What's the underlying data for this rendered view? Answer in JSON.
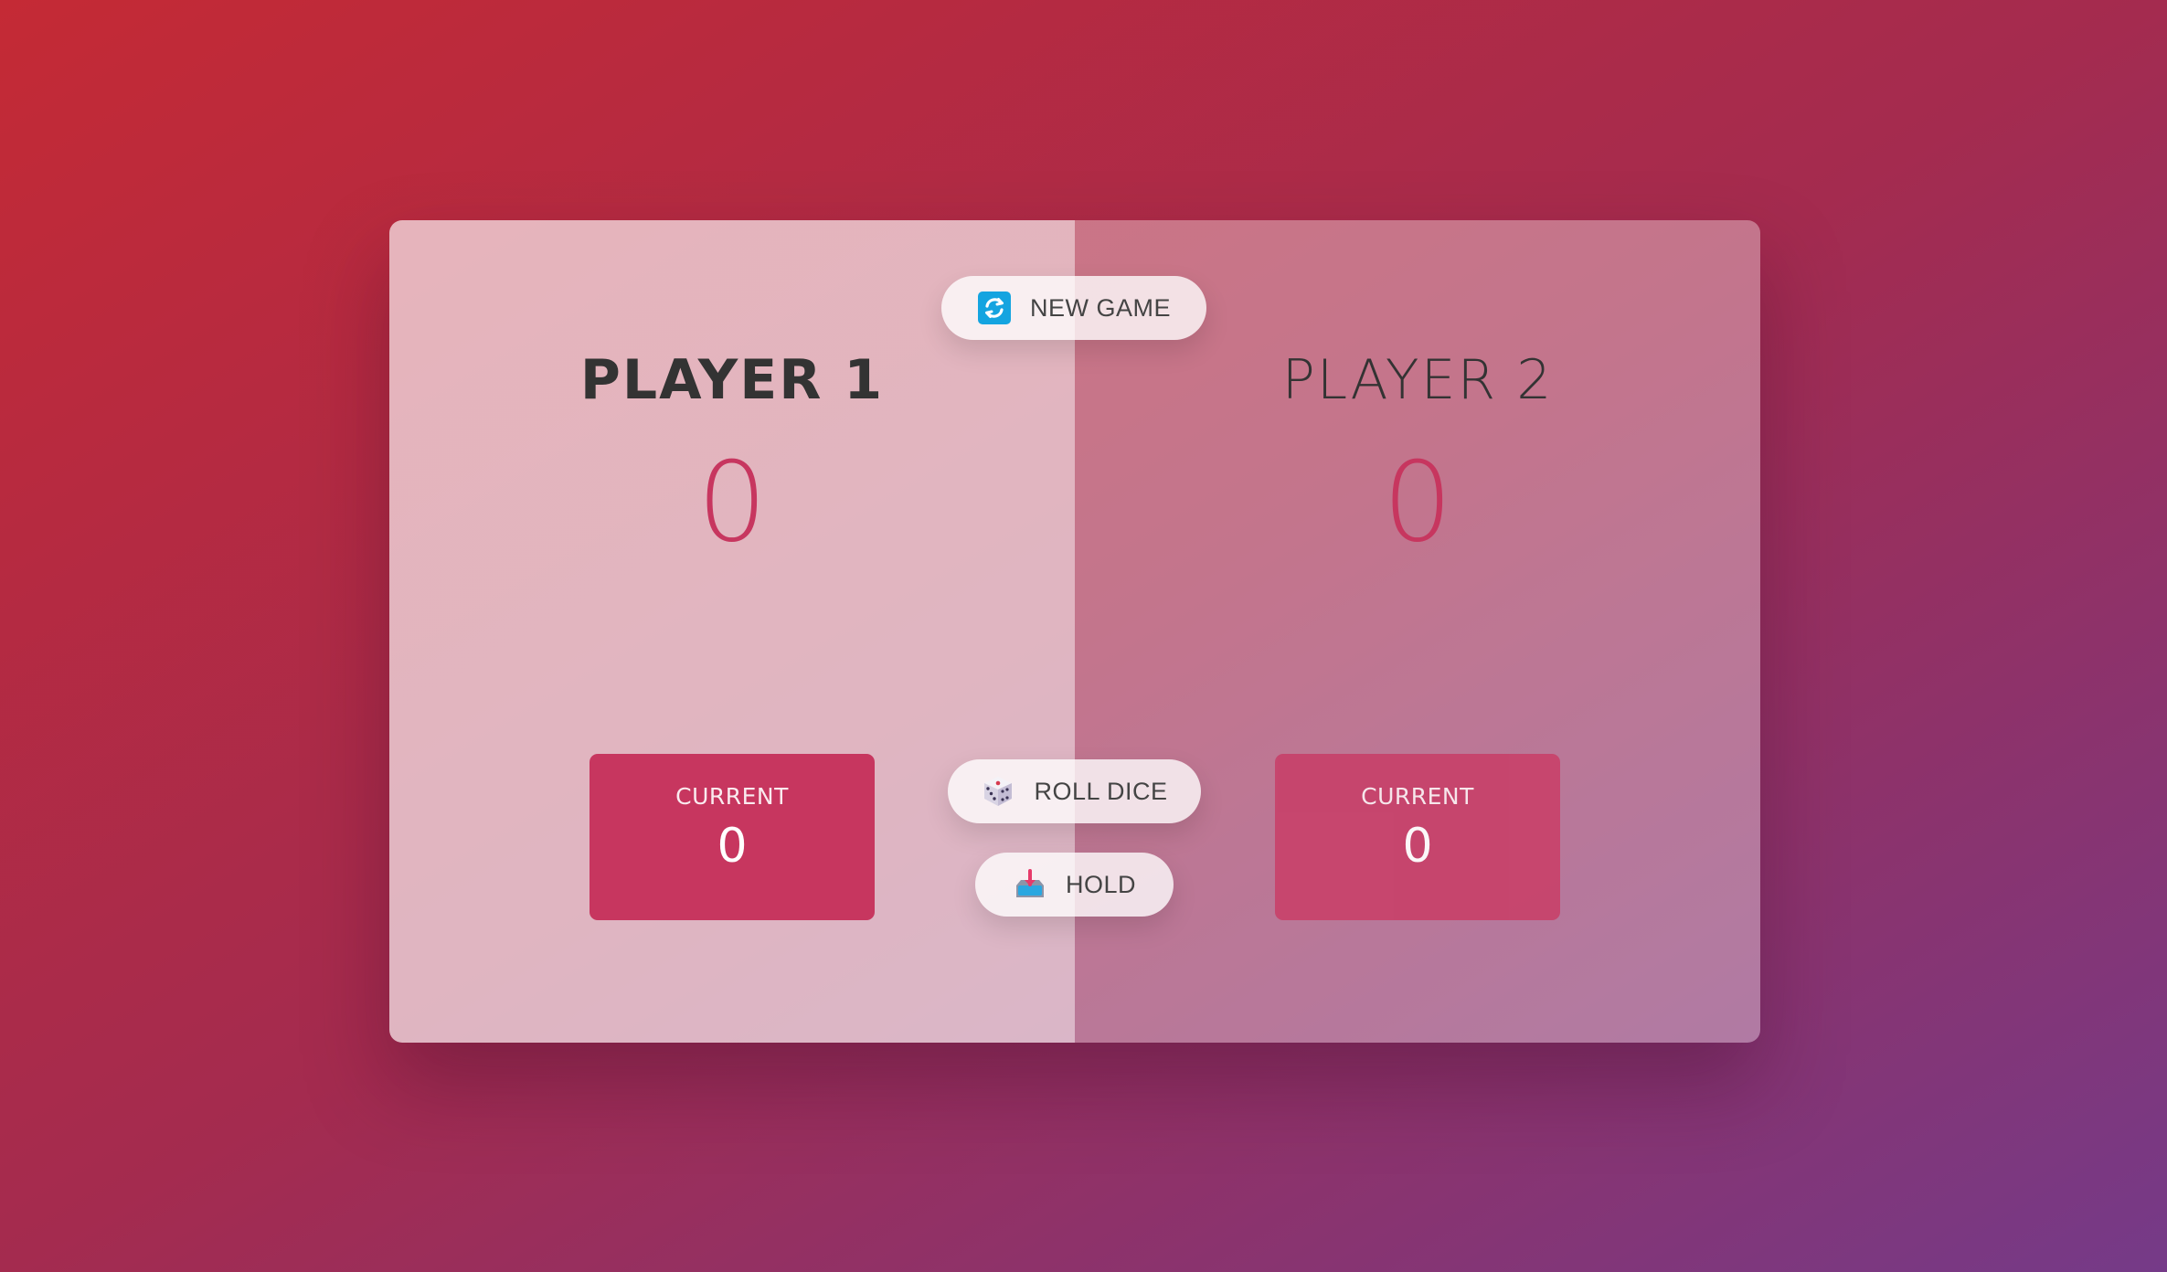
{
  "players": [
    {
      "name": "PLAYER 1",
      "score": "0",
      "current_label": "CURRENT",
      "current_score": "0",
      "active": true
    },
    {
      "name": "PLAYER 2",
      "score": "0",
      "current_label": "CURRENT",
      "current_score": "0",
      "active": false
    }
  ],
  "buttons": {
    "new_game": {
      "label": "NEW GAME",
      "icon": "refresh-icon"
    },
    "roll_dice": {
      "label": "ROLL DICE",
      "icon": "dice-icon"
    },
    "hold": {
      "label": "HOLD",
      "icon": "inbox-tray-icon"
    }
  },
  "colors": {
    "accent": "#c7365f",
    "background_start": "#c42a35",
    "background_end": "#753a88"
  }
}
